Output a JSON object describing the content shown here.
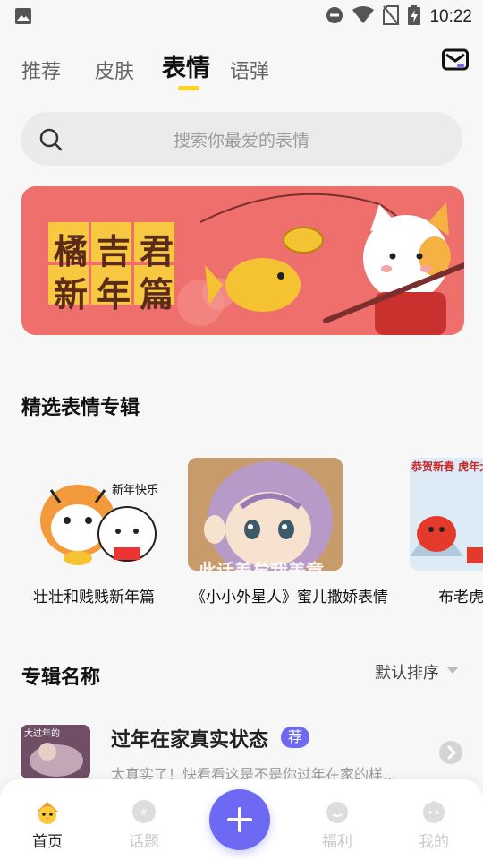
{
  "status_bar": {
    "time": "10:22"
  },
  "tabs": [
    {
      "label": "推荐",
      "active": false
    },
    {
      "label": "皮肤",
      "active": false
    },
    {
      "label": "表情",
      "active": true
    },
    {
      "label": "语弹",
      "active": false
    }
  ],
  "search": {
    "placeholder": "搜索你最爱的表情"
  },
  "banner": {
    "title_line1": "橘吉君",
    "title_line2": "新年篇"
  },
  "featured": {
    "title": "精选表情专辑",
    "albums": [
      {
        "label": "壮壮和贱贱新年篇",
        "sticker_text": "新年快乐"
      },
      {
        "label": "《小小外星人》蜜儿撒娇表情",
        "caption": "此话差矣我盖章"
      },
      {
        "label": "布老虎",
        "sticker_text": "恭贺新春 虎年大吉大利"
      }
    ]
  },
  "album_section": {
    "title": "专辑名称",
    "sort_label": "默认排序"
  },
  "list": [
    {
      "title": "过年在家真实状态",
      "badge": "荐",
      "desc": "太真实了！快看看这是不是你过年在家的样...",
      "thumb_text": "大过年的"
    }
  ],
  "bottom_nav": [
    {
      "label": "首页",
      "icon": "home-chick-icon",
      "active": true
    },
    {
      "label": "话题",
      "icon": "topic-bubble-icon",
      "active": false
    },
    {
      "label": "福利",
      "icon": "welfare-icon",
      "active": false
    },
    {
      "label": "我的",
      "icon": "profile-icon",
      "active": false
    }
  ],
  "colors": {
    "accent": "#6d69f2",
    "tab_underline": "#ffd21f",
    "banner_bg": "#ef6f6c"
  }
}
